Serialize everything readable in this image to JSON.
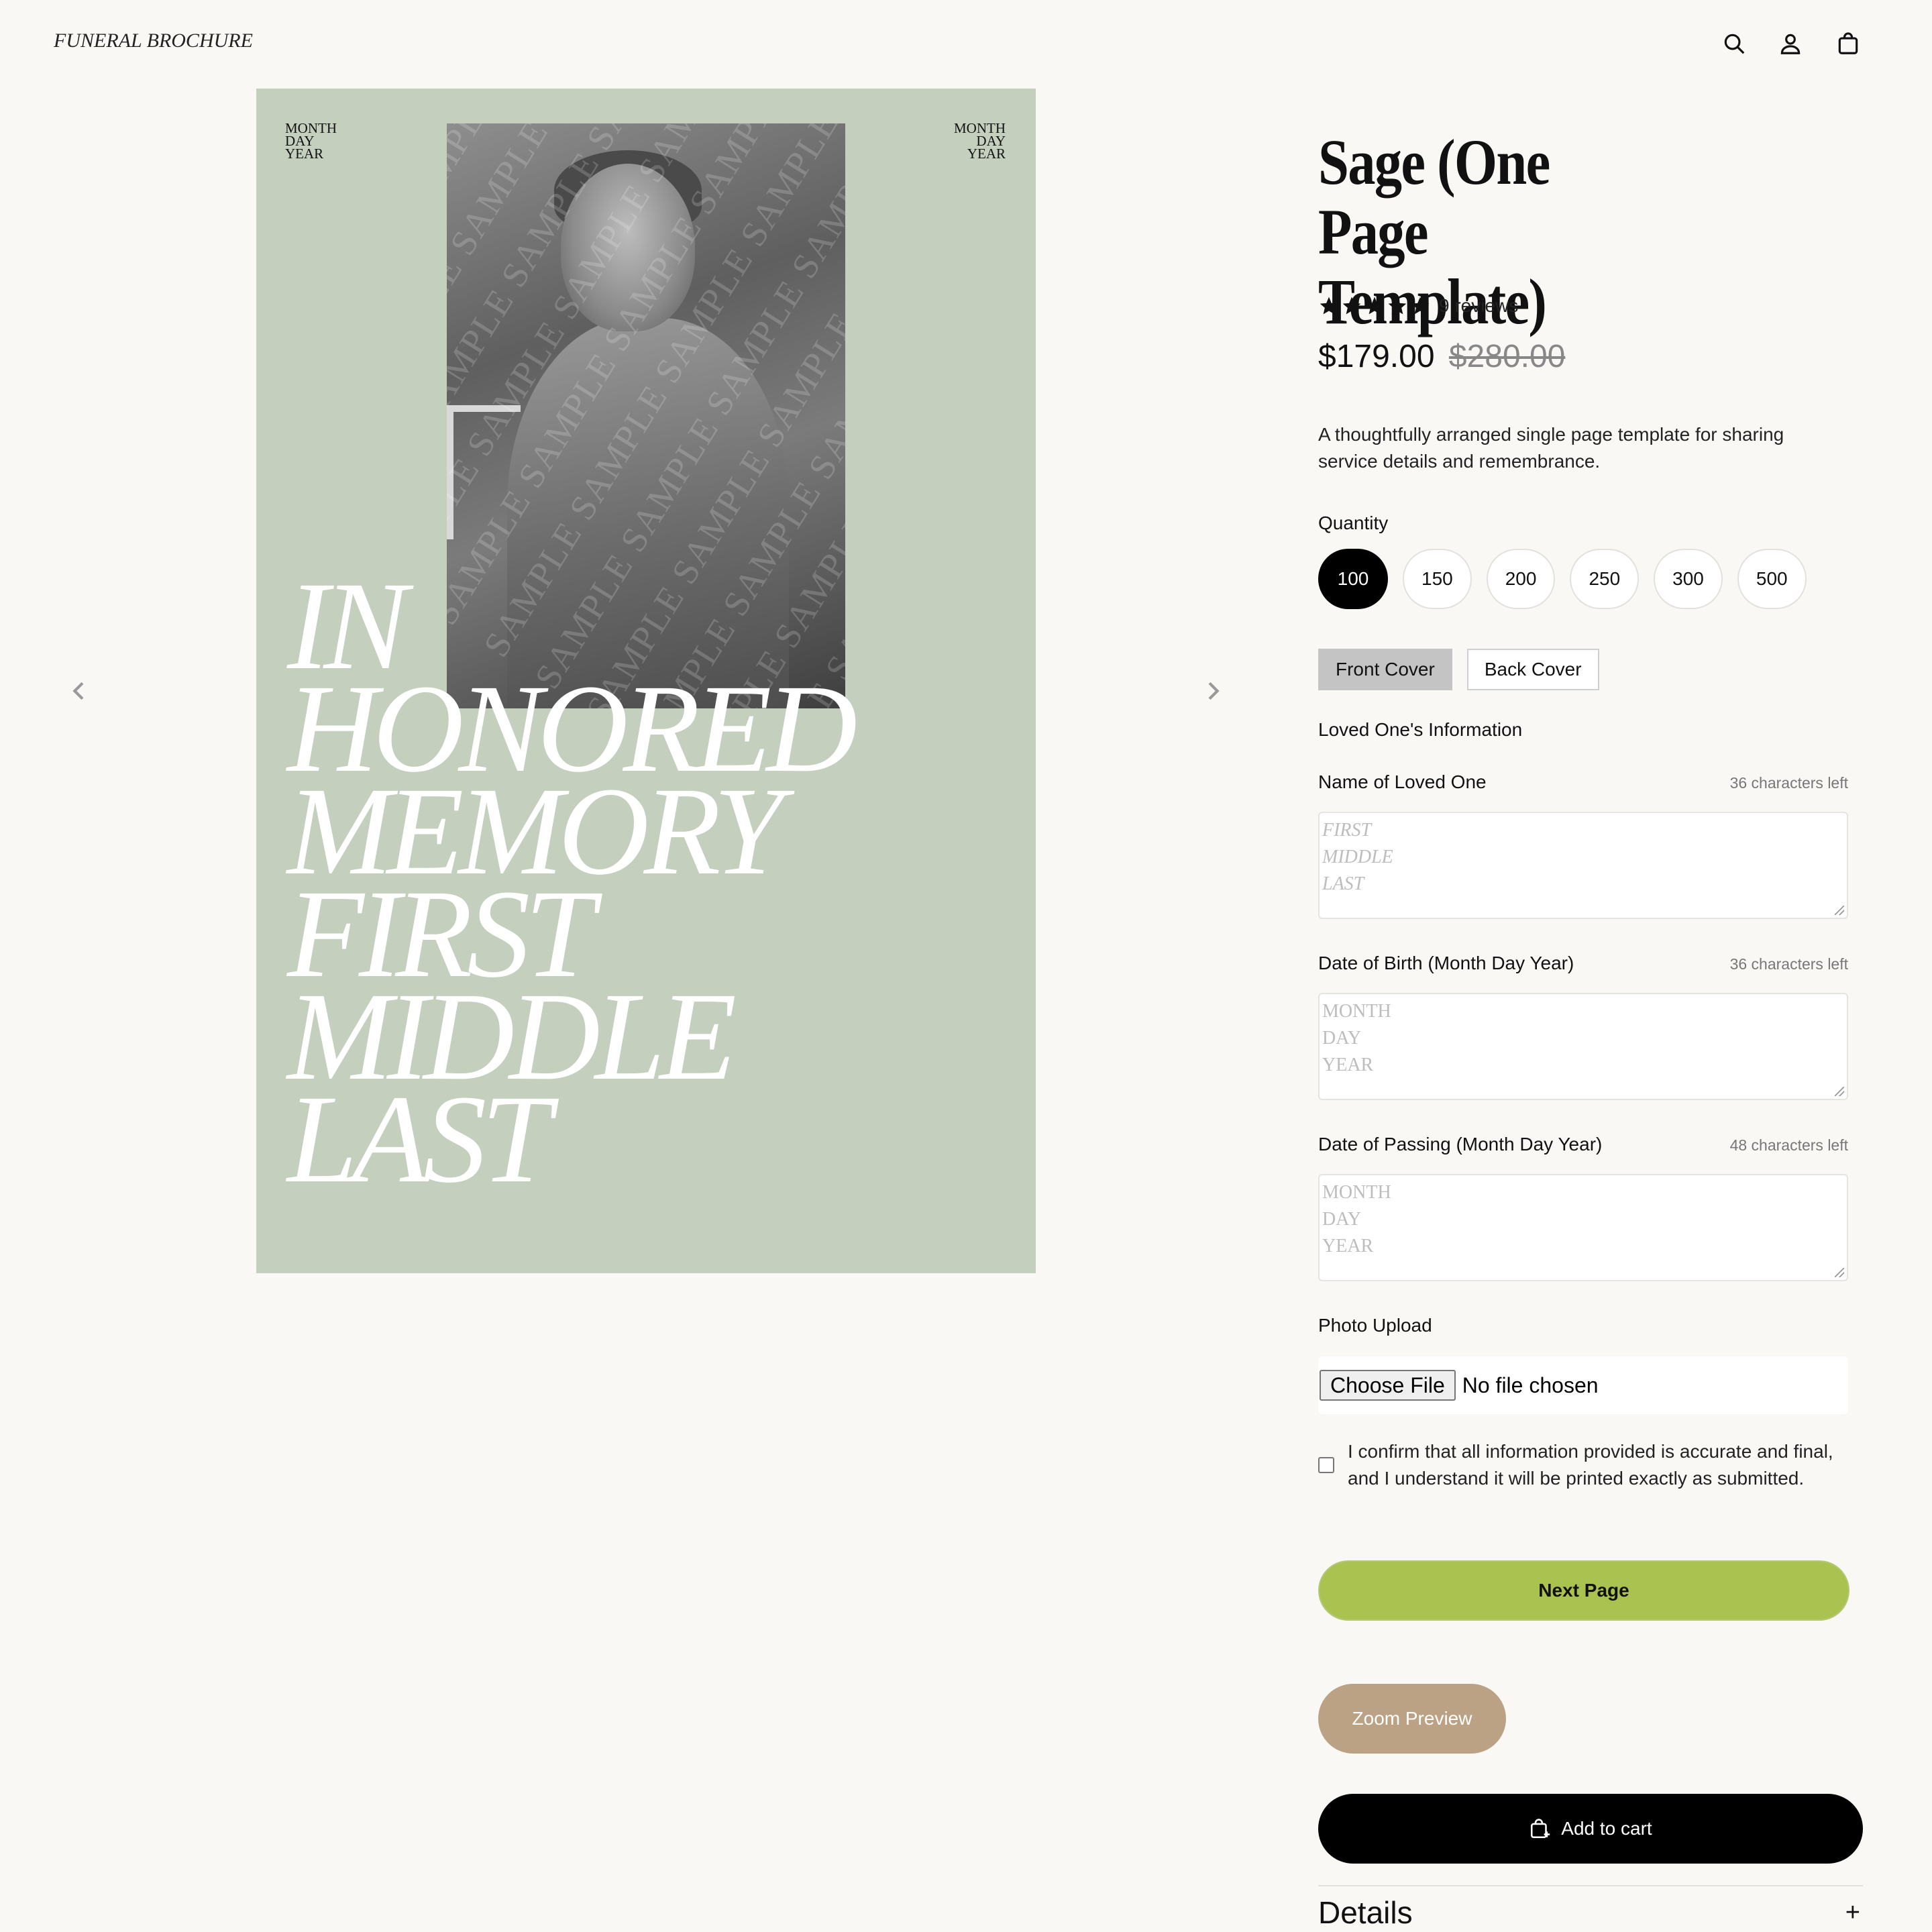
{
  "header": {
    "logo": "FUNERAL BROCHURE",
    "icons": [
      "search-icon",
      "account-icon",
      "cart-icon"
    ]
  },
  "preview": {
    "date_left": [
      "MONTH",
      "DAY",
      "YEAR"
    ],
    "date_right": [
      "MONTH",
      "DAY",
      "YEAR"
    ],
    "watermark": "SAMPLE",
    "memory_lines": [
      "IN",
      "HONORED",
      "MEMORY",
      "FIRST",
      "MIDDLE",
      "LAST"
    ],
    "background_color": "#c4cfbe"
  },
  "product": {
    "title": "Sage (One Page Template)",
    "rating": 5,
    "reviews": "9 reviews",
    "price": "$179.00",
    "compare_price": "$280.00",
    "description": "A thoughtfully arranged single page template for sharing service details and remembrance."
  },
  "quantity": {
    "label": "Quantity",
    "options": [
      "100",
      "150",
      "200",
      "250",
      "300",
      "500"
    ],
    "selected": "100"
  },
  "cover_tabs": {
    "front": "Front Cover",
    "back": "Back Cover",
    "selected": "Front Cover"
  },
  "form": {
    "section_label": "Loved One's Information",
    "name": {
      "label": "Name of Loved One",
      "chars_left": "36 characters left",
      "placeholder": [
        "FIRST",
        "MIDDLE",
        "LAST"
      ]
    },
    "dob": {
      "label": "Date of Birth (Month Day Year)",
      "chars_left": "36 characters left",
      "placeholder": [
        "MONTH",
        "DAY",
        "YEAR"
      ]
    },
    "dop": {
      "label": "Date of Passing (Month Day Year)",
      "chars_left": "48 characters left",
      "placeholder": [
        "MONTH",
        "DAY",
        "YEAR"
      ]
    },
    "photo": {
      "label": "Photo Upload",
      "button": "Choose File",
      "status": "No file chosen"
    },
    "confirm": "I confirm that all information provided is accurate and final, and I understand it will be printed exactly as submitted."
  },
  "actions": {
    "next": "Next Page",
    "zoom": "Zoom Preview",
    "add_to_cart": "Add to cart"
  },
  "details": {
    "label": "Details",
    "toggle": "+"
  },
  "colors": {
    "next_button": "#aac24f",
    "zoom_button": "#bba284",
    "cart_button": "#000000",
    "page_background": "#f9f8f5"
  }
}
